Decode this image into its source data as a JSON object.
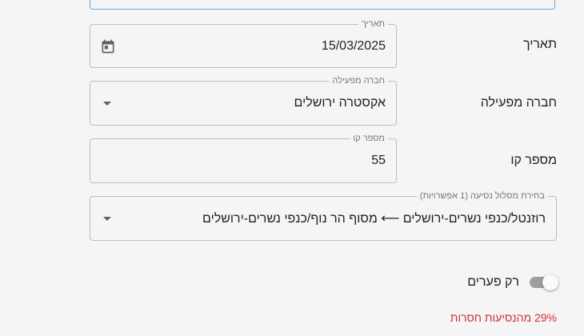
{
  "colors": {
    "accent": "#4ab0d8",
    "warning": "#d32f2f"
  },
  "date_row": {
    "label": "תאריך",
    "legend": "תאריך",
    "value": "15/03/2025",
    "icon": "calendar-icon"
  },
  "operator_row": {
    "label": "חברה מפעילה",
    "legend": "חברה מפעילה",
    "value": "אקסטרה ירושלים",
    "icon": "dropdown-arrow-icon"
  },
  "line_row": {
    "label": "מספר קו",
    "legend": "מספר קו",
    "value": "55"
  },
  "route_row": {
    "legend": "בחירת מסלול נסיעה (1 אפשרויות)",
    "value": "רוזנטל/כנפי נשרים-ירושלים ⟵ מסוף הר נוף/כנפי נשרים-ירושלים",
    "icon": "dropdown-arrow-icon"
  },
  "gaps_toggle": {
    "label": "רק פערים",
    "checked": true
  },
  "missing_rides_text": "29% מהנסיעות חסרות"
}
